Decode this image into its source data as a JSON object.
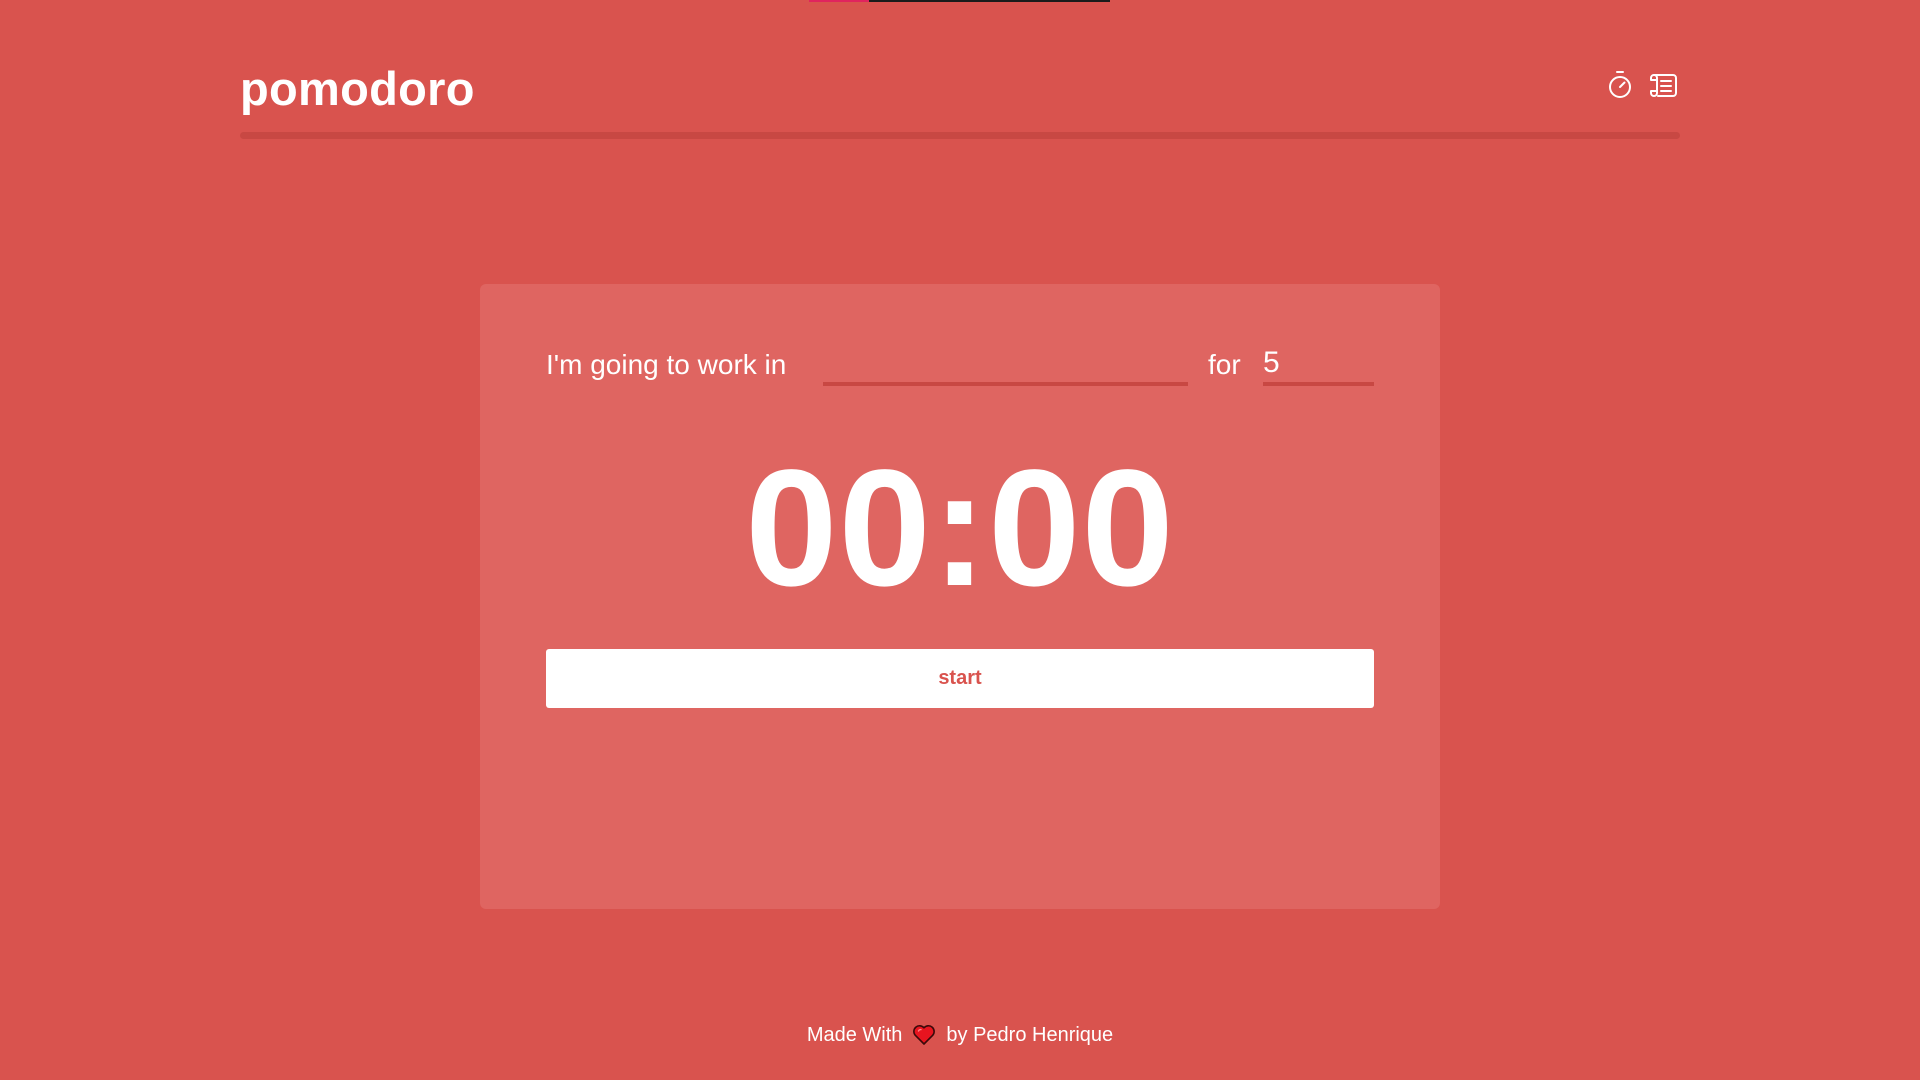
{
  "app": {
    "title": "pomodoro",
    "progress_fraction": 0.2,
    "accent_color": "#d9534e",
    "card_color": "#df6561",
    "rule_color": "#c84843",
    "indicator_color": "#e0245e"
  },
  "header": {
    "icons": [
      {
        "name": "stopwatch-icon"
      },
      {
        "name": "history-scroll-icon"
      }
    ]
  },
  "task": {
    "label": "I'm going to work in",
    "task_value": "",
    "for_label": "for",
    "minutes_value": "5"
  },
  "timer": {
    "display": "00:00"
  },
  "controls": {
    "start_label": "start"
  },
  "footer": {
    "made_with": "Made With",
    "heart_icon": "heart-icon",
    "by_text": "by Pedro Henrique"
  }
}
